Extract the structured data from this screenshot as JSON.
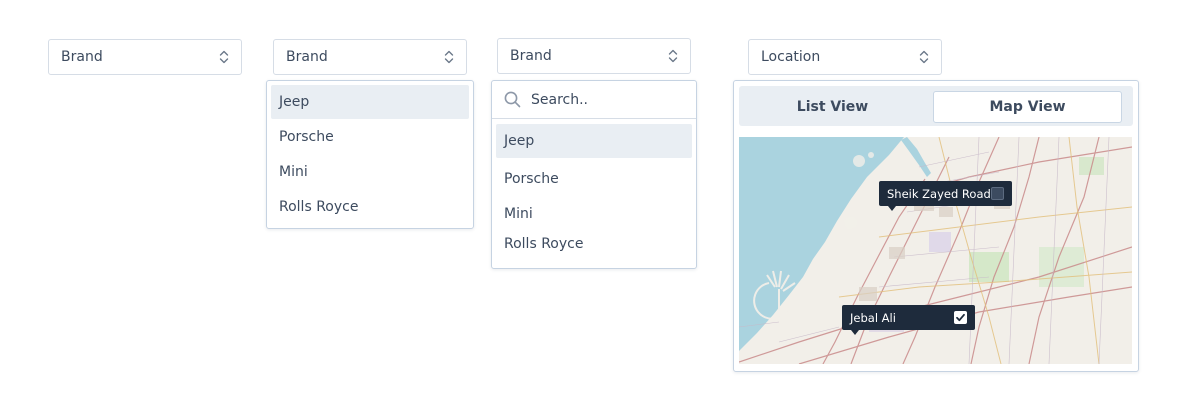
{
  "selects": {
    "brand_label": "Brand",
    "location_label": "Location"
  },
  "dropdown_basic": {
    "options": [
      "Jeep",
      "Porsche",
      "Mini",
      "Rolls Royce"
    ],
    "active_index": 0
  },
  "dropdown_search": {
    "search_placeholder": "Search..",
    "options": [
      "Jeep",
      "Porsche",
      "Mini",
      "Rolls Royce"
    ],
    "active_index": 0
  },
  "location_panel": {
    "tabs": [
      {
        "label": "List View",
        "selected": false
      },
      {
        "label": "Map View",
        "selected": true
      }
    ],
    "pins": [
      {
        "label": "Sheik Zayed Road",
        "checked": false
      },
      {
        "label": "Jebal Ali",
        "checked": true
      }
    ]
  },
  "icons": {
    "select_arrow": "chevron-up-down-icon",
    "search": "search-icon",
    "check": "checkmark-icon"
  },
  "colors": {
    "border": "#d6dde6",
    "active_bg": "#e9eef3",
    "text": "#3d4b5f",
    "pin_bg": "#1e2b3c",
    "water": "#aad3df",
    "land": "#f2efe9"
  }
}
